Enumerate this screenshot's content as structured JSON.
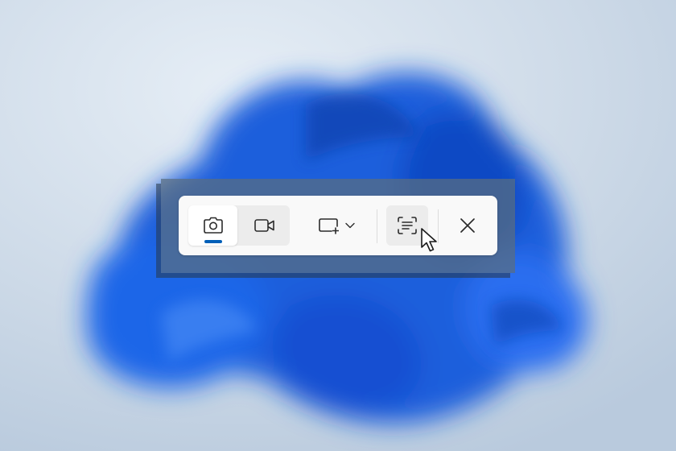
{
  "desktop": {
    "wallpaper": "windows-11-bloom-wallpaper",
    "background_color": "#d3dfea",
    "accent_blue": "#1c63e8"
  },
  "snipping_toolbar": {
    "modes": [
      {
        "name": "snip",
        "icon": "camera-icon",
        "selected": true
      },
      {
        "name": "record",
        "icon": "video-camera-icon",
        "selected": false
      }
    ],
    "snip_shape": {
      "icon": "rectangle-snip-icon",
      "dropdown_icon": "chevron-down-icon"
    },
    "text_extractor": {
      "icon": "text-extract-icon",
      "hovered": true
    },
    "close": {
      "icon": "close-icon"
    },
    "selected_indicator_color": "#005fb8"
  },
  "pointer": {
    "icon": "mouse-pointer-icon"
  }
}
